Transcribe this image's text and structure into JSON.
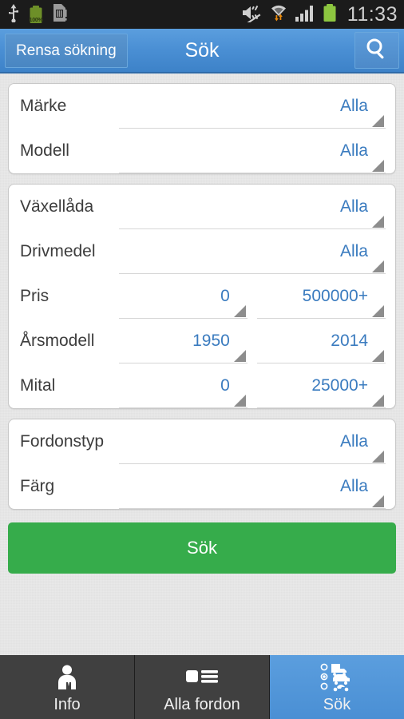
{
  "statusbar": {
    "time": "11:33",
    "battery_percent": "100%",
    "icons_left": [
      "usb-icon",
      "battery-charge-icon",
      "sd-card-warning-icon"
    ],
    "icons_right": [
      "mute-icon",
      "wifi-transfer-icon",
      "signal-bars-icon",
      "battery-icon"
    ]
  },
  "header": {
    "clear_label": "Rensa sökning",
    "title": "Sök",
    "search_icon": "search-icon",
    "accent_color": "#4a8fd4"
  },
  "cards": [
    {
      "rows": [
        {
          "label": "Märke",
          "fields": [
            {
              "value": "Alla"
            }
          ]
        },
        {
          "label": "Modell",
          "fields": [
            {
              "value": "Alla"
            }
          ]
        }
      ]
    },
    {
      "rows": [
        {
          "label": "Växellåda",
          "fields": [
            {
              "value": "Alla"
            }
          ]
        },
        {
          "label": "Drivmedel",
          "fields": [
            {
              "value": "Alla"
            }
          ]
        },
        {
          "label": "Pris",
          "fields": [
            {
              "value": "0"
            },
            {
              "value": "500000+"
            }
          ]
        },
        {
          "label": "Årsmodell",
          "fields": [
            {
              "value": "1950"
            },
            {
              "value": "2014"
            }
          ]
        },
        {
          "label": "Mital",
          "fields": [
            {
              "value": "0"
            },
            {
              "value": "25000+"
            }
          ]
        }
      ]
    },
    {
      "rows": [
        {
          "label": "Fordonstyp",
          "fields": [
            {
              "value": "Alla"
            }
          ]
        },
        {
          "label": "Färg",
          "fields": [
            {
              "value": "Alla"
            }
          ]
        }
      ]
    }
  ],
  "submit": {
    "label": "Sök",
    "color": "#36ac4b"
  },
  "tabbar": {
    "tabs": [
      {
        "label": "Info",
        "icon": "person-icon",
        "active": false
      },
      {
        "label": "Alla fordon",
        "icon": "list-icon",
        "active": false
      },
      {
        "label": "Sök",
        "icon": "vehicle-select-icon",
        "active": true
      }
    ]
  }
}
